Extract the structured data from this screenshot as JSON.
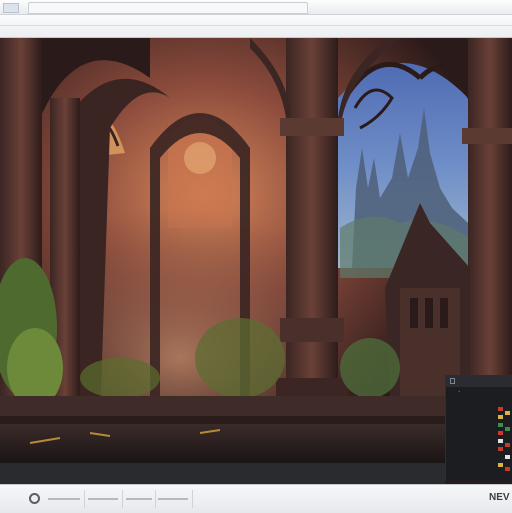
{
  "window": {
    "tab_label": ""
  },
  "panel": {
    "lines": [
      "•  ",
      "",
      "",
      "",
      "",
      "",
      "",
      "",
      "",
      "",
      "",
      "",
      "",
      ""
    ],
    "chip_colors": [
      "#c83a2a",
      "#d8b445",
      "#3a8d4a",
      "#c83a2a",
      "#e2e2e2",
      "#c83a2a",
      "#d8b445",
      "#3a8d4a",
      "#c83a2a",
      "#e2e2e2",
      "#d8b445",
      "#c83a2a"
    ]
  },
  "statusbar": {
    "icon": "settings-icon",
    "zoom_label": "NEV"
  },
  "colors": {
    "chrome": "#f3f4f6",
    "panel_bg": "#1c1d20"
  }
}
